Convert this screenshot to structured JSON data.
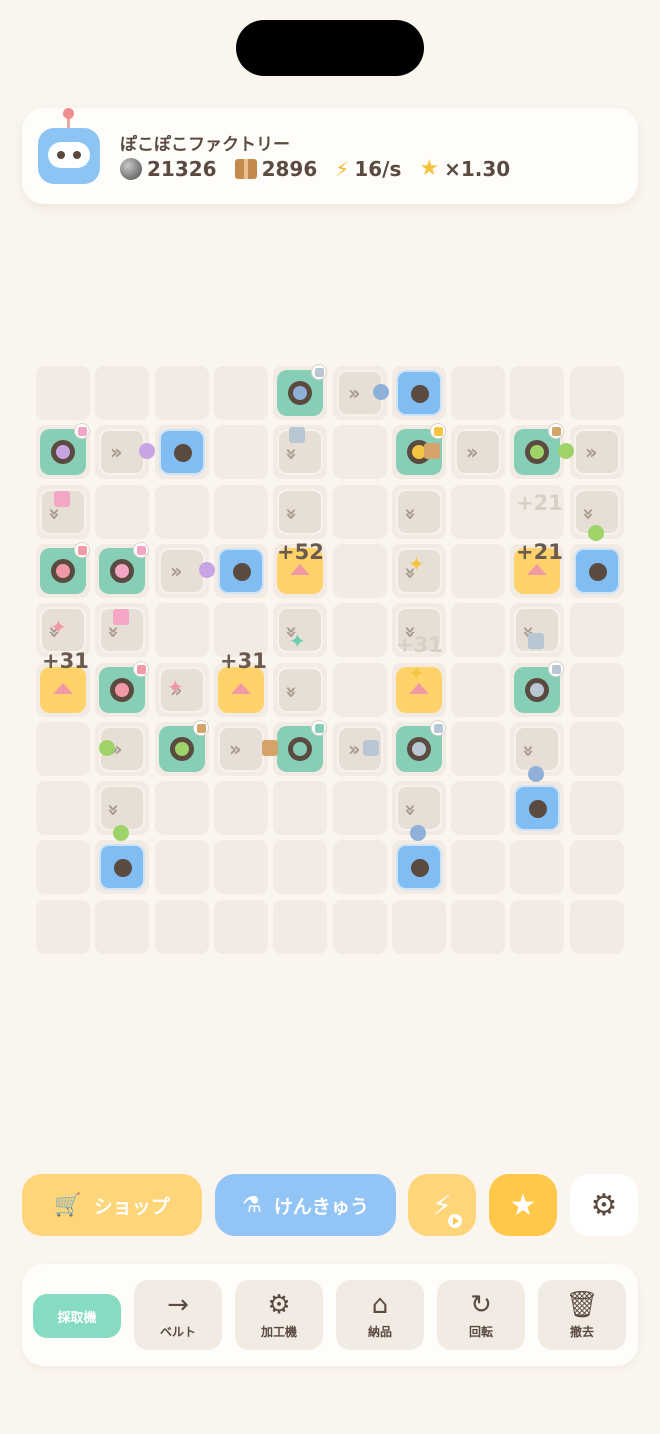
{
  "header": {
    "title": "ぽこぽこファクトリー",
    "stats": {
      "ore": "21326",
      "boxes": "2896",
      "power": "16/s",
      "multiplier": "×1.30"
    }
  },
  "grid_popups": [
    "+31",
    "+31",
    "+52",
    "+21",
    "+21",
    "+31"
  ],
  "buttons": {
    "shop": "ショップ",
    "research": "けんきゅう"
  },
  "toolbar": {
    "miner": "採取機",
    "belt": "ベルト",
    "processor": "加工機",
    "delivery": "納品",
    "rotate": "回転",
    "remove": "撤去"
  },
  "icons": {
    "ore": "rock-icon",
    "boxes": "box-icon",
    "power": "lightning-icon",
    "multiplier": "star-icon",
    "shop": "cart-icon",
    "research": "flask-icon",
    "boost": "lightning-play-icon",
    "favorite": "star-icon",
    "settings": "gear-icon",
    "belt": "arrow-right-icon",
    "processor": "gears-icon",
    "delivery": "house-icon",
    "rotate": "rotate-icon",
    "remove": "trash-icon"
  },
  "colors": {
    "background": "#faf5ef",
    "miner": "#86cfb6",
    "depot": "#7fbdf3",
    "processor": "#ffd36a",
    "shop": "#ffd57a",
    "research": "#93c4f6"
  }
}
